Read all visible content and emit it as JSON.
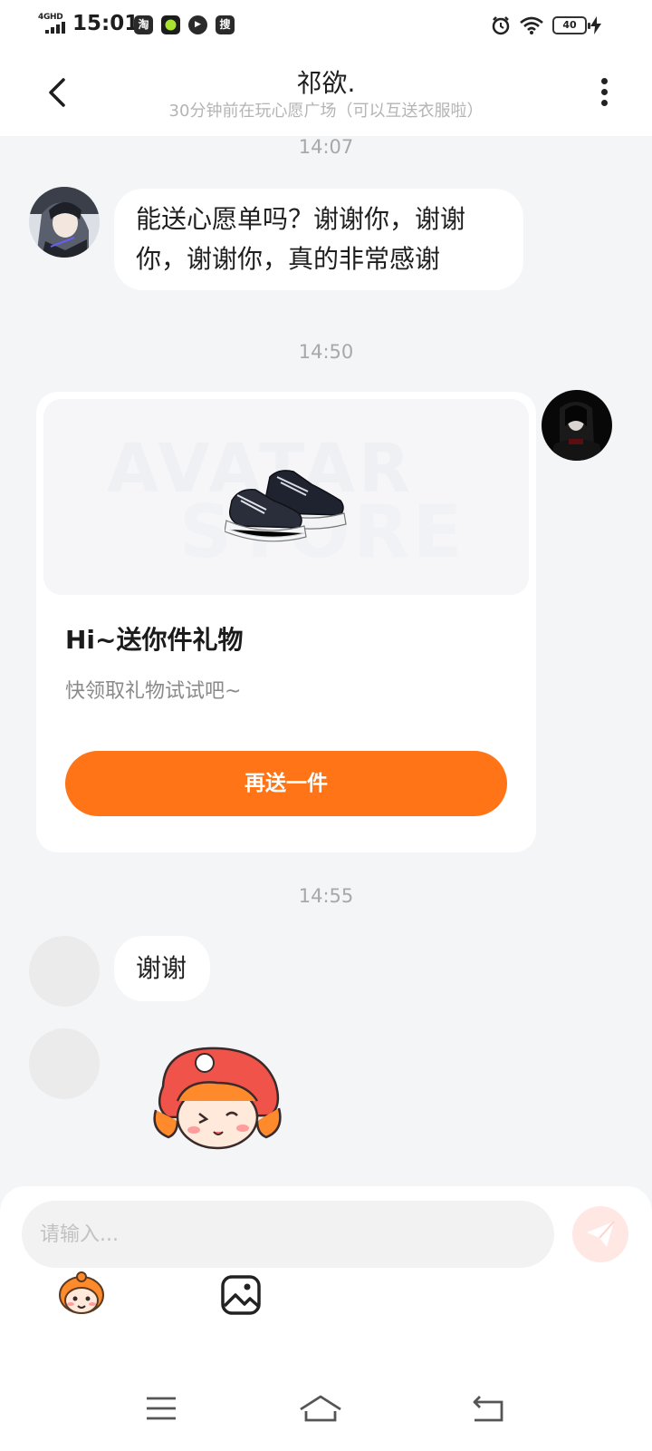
{
  "status_bar": {
    "network": "4GHD",
    "time": "15:01",
    "apps": [
      {
        "icon": "taobao-icon",
        "glyph": "淘"
      },
      {
        "icon": "green-app-icon",
        "glyph": ""
      },
      {
        "icon": "play-app-icon",
        "glyph": "▶"
      },
      {
        "icon": "search-app-icon",
        "glyph": "搜"
      }
    ],
    "battery": "40"
  },
  "header": {
    "title": "祁欲.",
    "subtitle": "30分钟前在玩心愿广场（可以互送衣服啦）"
  },
  "messages": {
    "time_1": "14:07",
    "text_1": "能送心愿单吗？谢谢你，谢谢你，谢谢你，真的非常感谢",
    "time_2": "14:50",
    "gift_card": {
      "title": "Hi~送你件礼物",
      "description": "快领取礼物试试吧~",
      "button_label": "再送一件",
      "image": "sneaker-image"
    },
    "time_3": "14:55",
    "text_2": "谢谢",
    "sticker": "mascot-sticker"
  },
  "input": {
    "placeholder": "请输入..."
  },
  "colors": {
    "accent": "#ff7416",
    "background": "#f4f5f7",
    "send_button": "#ffe7e4"
  }
}
